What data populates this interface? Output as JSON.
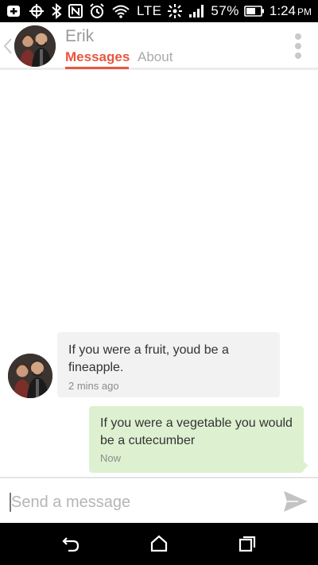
{
  "status_bar": {
    "network_label": "LTE",
    "battery": "57%",
    "time": "1:24",
    "ampm": "PM"
  },
  "header": {
    "contact_name": "Erik",
    "tabs": [
      {
        "label": "Messages",
        "active": true
      },
      {
        "label": "About",
        "active": false
      }
    ]
  },
  "messages": [
    {
      "direction": "incoming",
      "text": "If you were a fruit, youd be a fineapple.",
      "time": "2 mins ago"
    },
    {
      "direction": "outgoing",
      "text": "If you were a vegetable you would be a cutecumber",
      "time": "Now"
    }
  ],
  "composer": {
    "value": "",
    "placeholder": "Send a message"
  },
  "colors": {
    "accent": "#e8563f",
    "incoming_bubble": "#f2f2f2",
    "outgoing_bubble": "#ddf1d1"
  },
  "icons": {
    "status": [
      "plus-badge-icon",
      "crosshair-icon",
      "bluetooth-icon",
      "nfc-icon",
      "alarm-icon",
      "wifi-icon",
      "data-arrows-icon",
      "signal-icon",
      "battery-icon"
    ],
    "header": [
      "back-chevron-icon",
      "more-vertical-icon"
    ],
    "composer": [
      "send-icon"
    ],
    "nav": [
      "back-icon",
      "home-icon",
      "recents-icon"
    ]
  }
}
